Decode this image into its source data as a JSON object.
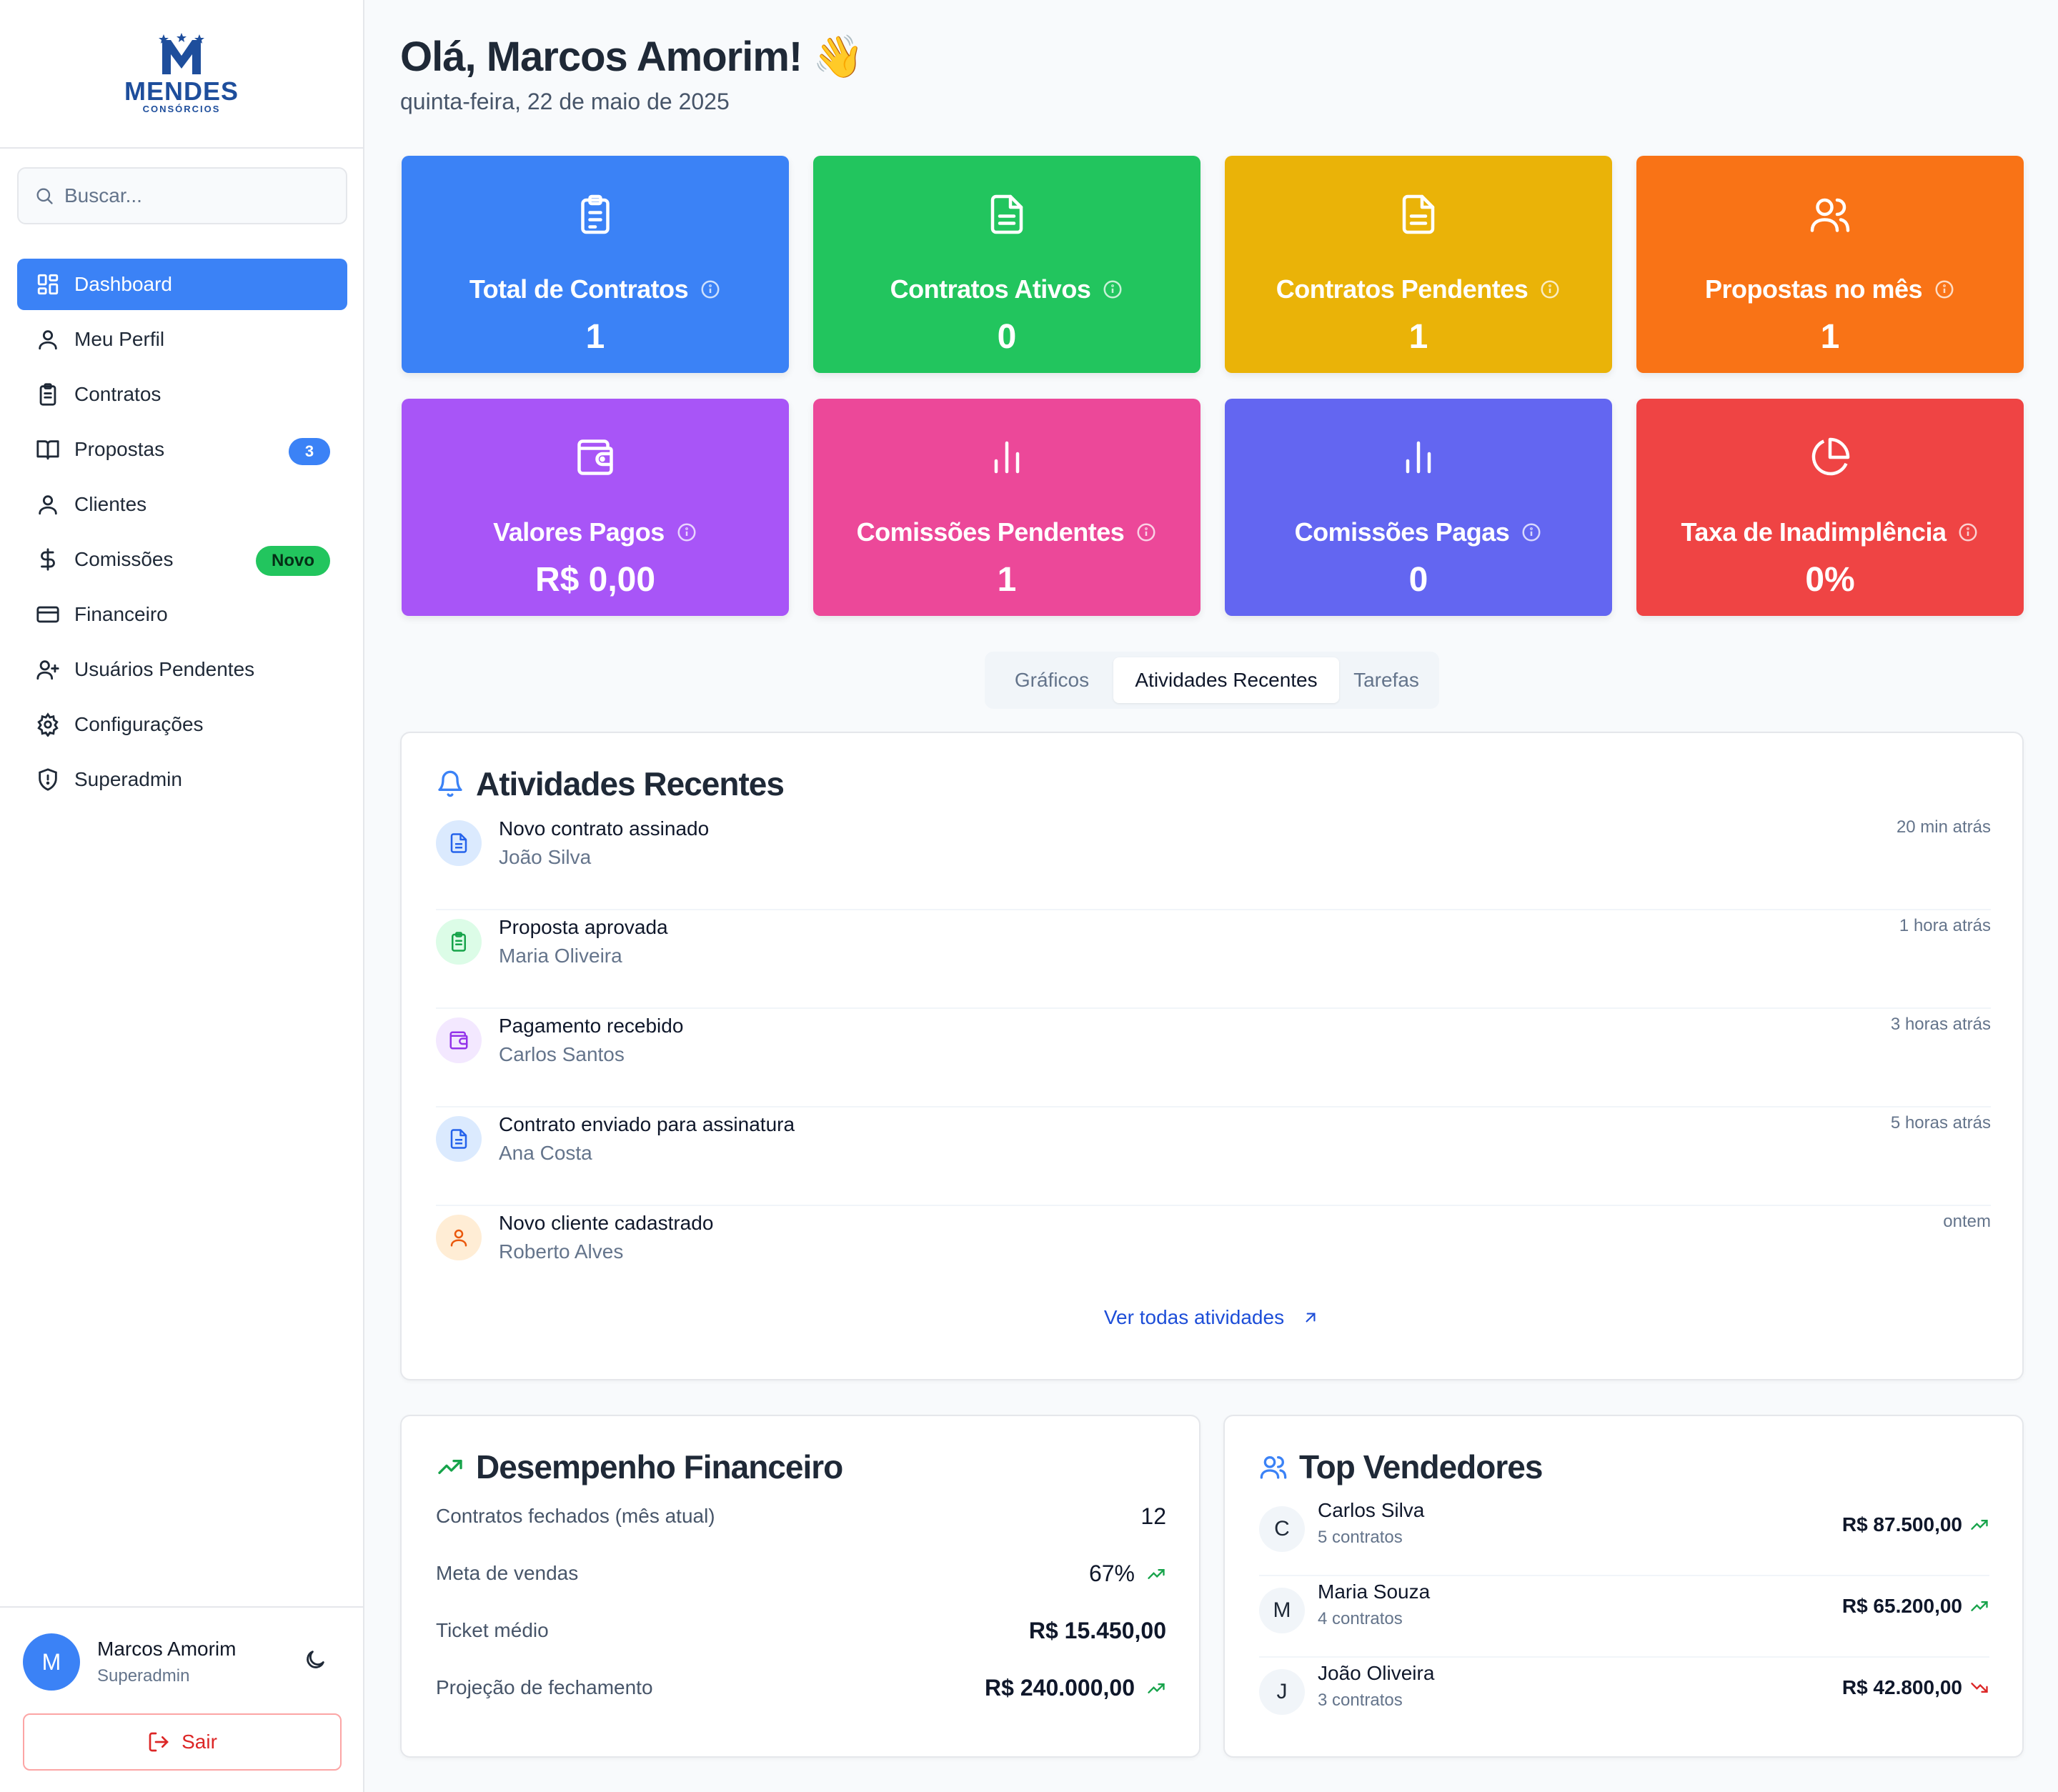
{
  "brand": {
    "name": "MENDES",
    "subtitle": "CONSÓRCIOS",
    "color": "#1e4e9c"
  },
  "search": {
    "placeholder": "Buscar..."
  },
  "sidebar": {
    "items": [
      {
        "label": "Dashboard",
        "icon": "dashboard-icon",
        "active": true
      },
      {
        "label": "Meu Perfil",
        "icon": "user-icon"
      },
      {
        "label": "Contratos",
        "icon": "clipboard-icon"
      },
      {
        "label": "Propostas",
        "icon": "book-icon",
        "badge": "3"
      },
      {
        "label": "Clientes",
        "icon": "user-icon"
      },
      {
        "label": "Comissões",
        "icon": "dollar-icon",
        "badge": "Novo"
      },
      {
        "label": "Financeiro",
        "icon": "credit-card-icon"
      },
      {
        "label": "Usuários Pendentes",
        "icon": "user-plus-icon"
      },
      {
        "label": "Configurações",
        "icon": "gear-icon"
      },
      {
        "label": "Superadmin",
        "icon": "shield-icon"
      }
    ]
  },
  "user": {
    "initial": "M",
    "name": "Marcos Amorim",
    "role": "Superadmin",
    "logout": "Sair"
  },
  "header": {
    "greeting": "Olá, Marcos Amorim! 👋",
    "date": "quinta-feira, 22 de maio de 2025"
  },
  "stats": [
    {
      "title": "Total de Contratos",
      "value": "1",
      "color": "#3b82f6",
      "icon": "clipboard-icon"
    },
    {
      "title": "Contratos Ativos",
      "value": "0",
      "color": "#22c55e",
      "icon": "document-icon"
    },
    {
      "title": "Contratos Pendentes",
      "value": "1",
      "color": "#eab308",
      "icon": "document-icon"
    },
    {
      "title": "Propostas no mês",
      "value": "1",
      "color": "#f97316",
      "icon": "users-icon"
    },
    {
      "title": "Valores Pagos",
      "value": "R$ 0,00",
      "color": "#a855f7",
      "icon": "wallet-icon"
    },
    {
      "title": "Comissões Pendentes",
      "value": "1",
      "color": "#ec4899",
      "icon": "bar-chart-icon"
    },
    {
      "title": "Comissões Pagas",
      "value": "0",
      "color": "#6366f1",
      "icon": "bar-chart-icon"
    },
    {
      "title": "Taxa de Inadimplência",
      "value": "0%",
      "color": "#ef4444",
      "icon": "pie-chart-icon"
    }
  ],
  "tabs": [
    {
      "label": "Gráficos"
    },
    {
      "label": "Atividades Recentes",
      "active": true
    },
    {
      "label": "Tarefas"
    }
  ],
  "activities": {
    "title": "Atividades Recentes",
    "items": [
      {
        "title": "Novo contrato assinado",
        "person": "João Silva",
        "time": "20 min atrás",
        "icon": "document-icon",
        "color": "#2563eb",
        "bg": "#dbeafe"
      },
      {
        "title": "Proposta aprovada",
        "person": "Maria Oliveira",
        "time": "1 hora atrás",
        "icon": "clipboard-icon",
        "color": "#16a34a",
        "bg": "#dcfce7"
      },
      {
        "title": "Pagamento recebido",
        "person": "Carlos Santos",
        "time": "3 horas atrás",
        "icon": "wallet-icon",
        "color": "#9333ea",
        "bg": "#f3e8ff"
      },
      {
        "title": "Contrato enviado para assinatura",
        "person": "Ana Costa",
        "time": "5 horas atrás",
        "icon": "document-icon",
        "color": "#2563eb",
        "bg": "#dbeafe"
      },
      {
        "title": "Novo cliente cadastrado",
        "person": "Roberto Alves",
        "time": "ontem",
        "icon": "user-icon",
        "color": "#ea580c",
        "bg": "#ffedd5"
      }
    ],
    "see_all": "Ver todas atividades"
  },
  "financial": {
    "title": "Desempenho Financeiro",
    "rows": [
      {
        "label": "Contratos fechados (mês atual)",
        "value": "12"
      },
      {
        "label": "Meta de vendas",
        "value": "67%",
        "trend": "up"
      },
      {
        "label": "Ticket médio",
        "value": "R$ 15.450,00"
      },
      {
        "label": "Projeção de fechamento",
        "value": "R$ 240.000,00",
        "trend": "up"
      }
    ]
  },
  "sellers": {
    "title": "Top Vendedores",
    "items": [
      {
        "initial": "C",
        "name": "Carlos Silva",
        "contracts": "5 contratos",
        "value": "R$ 87.500,00",
        "trend": "up"
      },
      {
        "initial": "M",
        "name": "Maria Souza",
        "contracts": "4 contratos",
        "value": "R$ 65.200,00",
        "trend": "up"
      },
      {
        "initial": "J",
        "name": "João Oliveira",
        "contracts": "3 contratos",
        "value": "R$ 42.800,00",
        "trend": "down"
      }
    ]
  }
}
